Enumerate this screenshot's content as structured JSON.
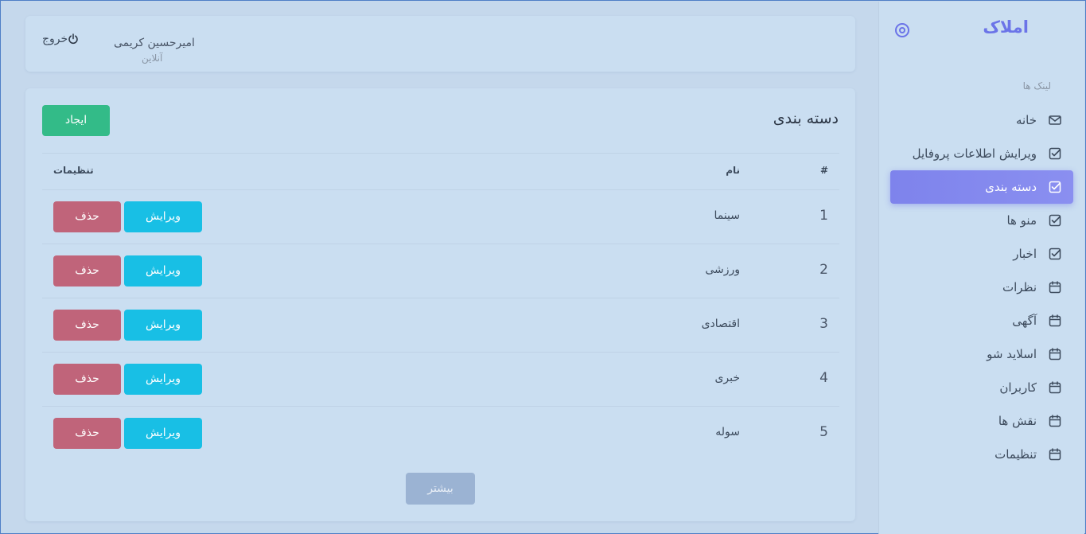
{
  "sidebar": {
    "brand": "املاک",
    "section_label": "لینک ها",
    "items": [
      {
        "label": "خانه",
        "icon": "mail-icon"
      },
      {
        "label": "ویرایش اطلاعات پروفایل",
        "icon": "checkbox-icon"
      },
      {
        "label": "دسته بندی",
        "icon": "checkbox-icon"
      },
      {
        "label": "منو ها",
        "icon": "checkbox-icon"
      },
      {
        "label": "اخبار",
        "icon": "checkbox-icon"
      },
      {
        "label": "نظرات",
        "icon": "calendar-icon"
      },
      {
        "label": "آگهی",
        "icon": "calendar-icon"
      },
      {
        "label": "اسلاید شو",
        "icon": "calendar-icon"
      },
      {
        "label": "کاربران",
        "icon": "calendar-icon"
      },
      {
        "label": "نقش ها",
        "icon": "calendar-icon"
      },
      {
        "label": "تنظیمات",
        "icon": "calendar-icon"
      }
    ],
    "active_index": 2
  },
  "header": {
    "user_name": "امیرحسین کریمی",
    "user_status": "آنلاین",
    "logout_label": "خروج"
  },
  "main": {
    "title": "دسته بندی",
    "create_label": "ایجاد",
    "columns": {
      "index": "#",
      "name": "نام",
      "settings": "تنظیمات"
    },
    "rows": [
      {
        "index": "1",
        "name": "سینما",
        "edit": "ویرایش",
        "delete": "حذف"
      },
      {
        "index": "2",
        "name": "ورزشی",
        "edit": "ویرایش",
        "delete": "حذف"
      },
      {
        "index": "3",
        "name": "اقتصادی",
        "edit": "ویرایش",
        "delete": "حذف"
      },
      {
        "index": "4",
        "name": "خبری",
        "edit": "ویرایش",
        "delete": "حذف"
      },
      {
        "index": "5",
        "name": "سوله",
        "edit": "ویرایش",
        "delete": "حذف"
      }
    ],
    "more_label": "بیشتر"
  },
  "colors": {
    "accent": "#7e83ec",
    "create": "#33bb88",
    "edit": "#18bfe5",
    "delete": "#c0647a",
    "more": "#9bb3d3"
  }
}
